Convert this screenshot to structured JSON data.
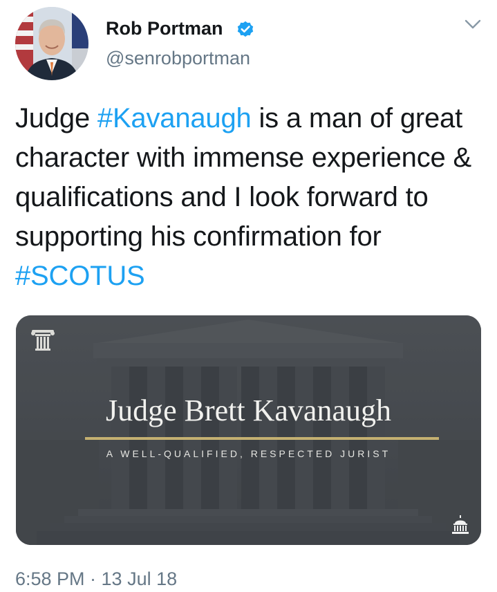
{
  "author": {
    "display_name": "Rob Portman",
    "handle": "@senrobportman",
    "verified": true
  },
  "icons": {
    "avatar": "profile-photo",
    "verified": "verified-badge-icon",
    "caret": "chevron-down-icon",
    "card_logo": "greek-column-icon",
    "card_corner": "capitol-building-icon"
  },
  "tweet": {
    "text_1": "Judge ",
    "hashtag_1": "#Kavanaugh",
    "text_2": " is a man of great character with immense experience & qualifications and I look forward to supporting his confirmation for ",
    "hashtag_2": "#SCOTUS"
  },
  "media_card": {
    "title": "Judge Brett Kavanaugh",
    "subtitle": "A WELL-QUALIFIED, RESPECTED JURIST"
  },
  "timestamp": "6:58 PM · 13 Jul 18",
  "colors": {
    "text": "#14171a",
    "secondary": "#657786",
    "link": "#1da1f2",
    "verified": "#1da1f2",
    "card_bg": "#4d5156",
    "card_rule": "#c4b071"
  }
}
